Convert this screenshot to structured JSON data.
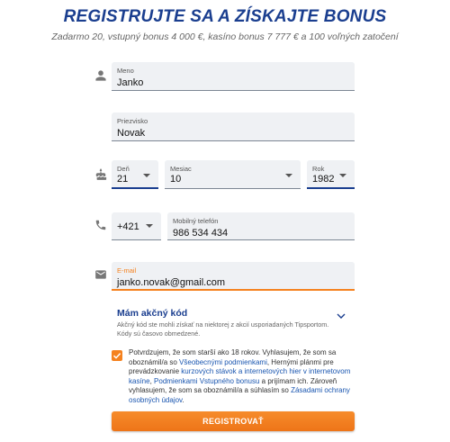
{
  "header": {
    "title": "REGISTRUJTE SA A ZÍSKAJTE BONUS",
    "subtitle": "Zadarmo 20, vstupný bonus 4 000 €, kasíno bonus 7 777 € a 100 voľných zatočení"
  },
  "form": {
    "first_name": {
      "label": "Meno",
      "value": "Janko"
    },
    "last_name": {
      "label": "Priezvisko",
      "value": "Novak"
    },
    "birth_day": {
      "label": "Deň",
      "value": "21"
    },
    "birth_month": {
      "label": "Mesiac",
      "value": "10"
    },
    "birth_year": {
      "label": "Rok",
      "value": "1982"
    },
    "phone_prefix": {
      "value": "+421"
    },
    "phone": {
      "label": "Mobilný telefón",
      "value": "986 534 434"
    },
    "email": {
      "label": "E-mail",
      "value": "janko.novak@gmail.com"
    }
  },
  "promo": {
    "title": "Mám akčný kód",
    "description": "Akčný kód ste mohli získať na niektorej z akcií usporiadaných Tipsportom. Kódy sú časovo obmedzené."
  },
  "consent": {
    "checked": true,
    "t1": "Potvrdzujem, že som starší ako 18 rokov. Vyhlasujem, že som sa oboznámil/a so ",
    "l1": "Všeobecnými podmienkami",
    "t2": ", Hernými plánmi pre prevádzkovanie ",
    "l2": "kurzových stávok a internetových hier v internetovom kasíne",
    "t3": ", ",
    "l3": "Podmienkami Vstupného bonusu",
    "t4": " a prijímam ich. Zároveň vyhlasujem, že som sa oboznámil/a a súhlasím so ",
    "l4": "Zásadami ochrany osobných údajov",
    "t5": "."
  },
  "submit_label": "REGISTROVAŤ",
  "colors": {
    "brand_blue": "#1a3e8f",
    "accent_orange": "#f5821f",
    "field_bg": "#eff1f4"
  },
  "icons": {
    "name_row": "person-icon",
    "birth_row": "cake-icon",
    "phone_row": "phone-icon",
    "email_row": "mail-icon"
  }
}
